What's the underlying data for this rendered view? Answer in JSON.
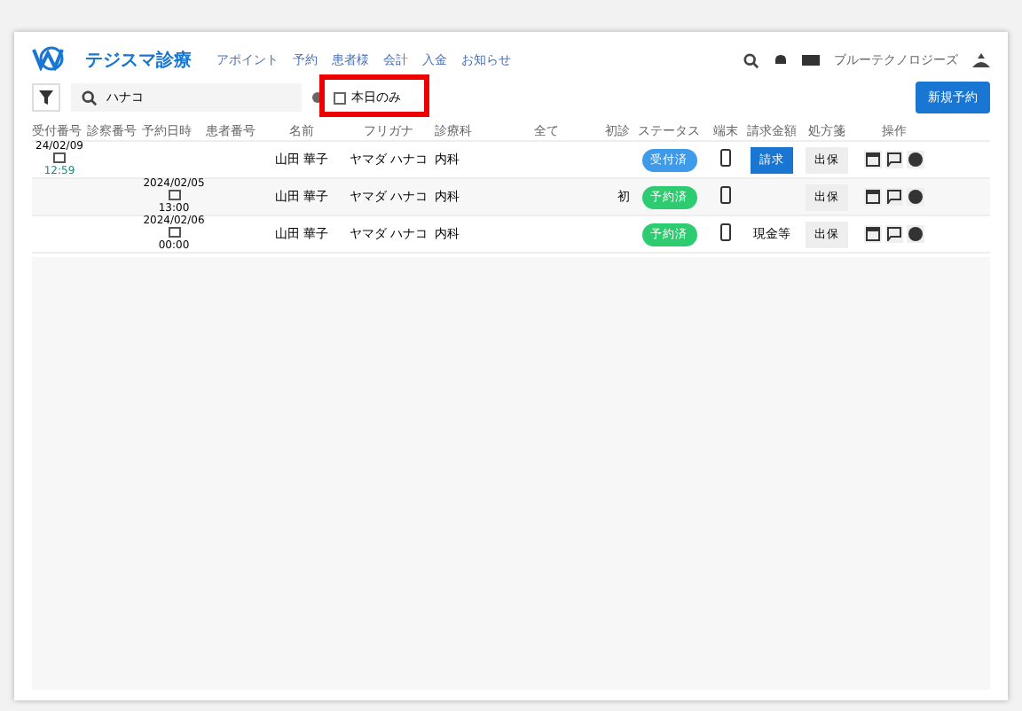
{
  "brand": "テジスマ診療",
  "nav": [
    "アポイント",
    "予約",
    "患者様",
    "会計",
    "入金",
    "お知らせ"
  ],
  "user": "ブルーテクノロジーズ",
  "search": {
    "value": "ハナコ"
  },
  "today_only": {
    "label": "本日のみ",
    "checked": false
  },
  "new_button": "新規予約",
  "columns": [
    "受付番号",
    "診察番号",
    "予約日時",
    "患者番号",
    "名前",
    "フリガナ",
    "診療科",
    "全て",
    "初診",
    "ステータス",
    "端末",
    "請求金額",
    "処方箋",
    "操作"
  ],
  "rows": [
    {
      "date": "24/02/09",
      "time": "12:59",
      "kind": "reception",
      "name": "山田 華子",
      "kana": "ヤマダ ハナコ",
      "dept": "内科",
      "status": {
        "label": "受付済",
        "kind": "received"
      },
      "bill": {
        "kind": "button",
        "label": "請求"
      },
      "rx": "出保"
    },
    {
      "date": "2024/02/05",
      "time": "13:00",
      "kind": "reservation",
      "name": "山田 華子",
      "kana": "ヤマダ ハナコ",
      "dept": "内科",
      "first": "初",
      "status": {
        "label": "予約済",
        "kind": "reserved"
      },
      "bill": {
        "kind": "none"
      },
      "rx": "出保"
    },
    {
      "date": "2024/02/06",
      "time": "00:00",
      "kind": "reservation",
      "name": "山田 華子",
      "kana": "ヤマダ ハナコ",
      "dept": "内科",
      "status": {
        "label": "予約済",
        "kind": "reserved"
      },
      "bill": {
        "kind": "text",
        "label": "現金等"
      },
      "rx": "出保"
    }
  ]
}
